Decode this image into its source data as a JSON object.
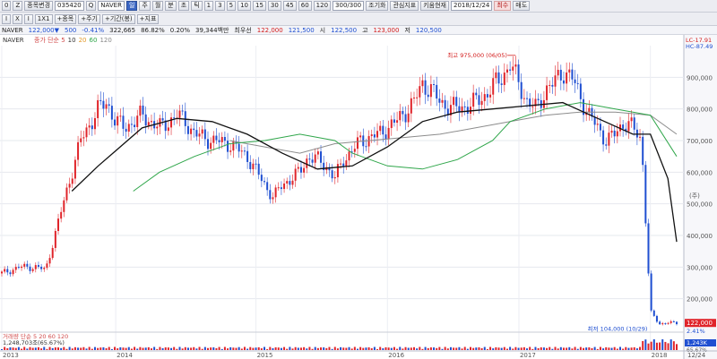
{
  "toolbar1": {
    "items": [
      "0",
      "Z",
      "종목변경",
      "035420",
      "Q",
      "NAVER",
      "일",
      "주",
      "월",
      "분",
      "초",
      "틱",
      "1",
      "3",
      "5",
      "10",
      "15",
      "30",
      "45",
      "60",
      "120",
      "300/300",
      "조기화",
      "관심지표",
      "키움현재",
      "2018/12/24",
      "최수",
      "매도"
    ],
    "indicator_tabs": [
      "+종목",
      "+주기",
      "+기간(봉)",
      "+지표"
    ]
  },
  "toolbar2": {
    "items": [
      "I",
      "X",
      "I",
      "1X1"
    ]
  },
  "info": {
    "name": "NAVER",
    "price": "122,000▼",
    "change": "500",
    "change_pct": "-0.41%",
    "volume": "322,665",
    "turnover": "86.82%",
    "rate": "0.20%",
    "amount": "39,344백만",
    "segment": "최우선",
    "bid": "122,000",
    "ask": "121,500",
    "open_label": "시",
    "open": "122,500",
    "high_label": "고",
    "high": "123,000",
    "low_label": "저",
    "low": "120,500"
  },
  "chart_data": {
    "type": "candlestick",
    "title": "NAVER",
    "legend": [
      "종가 단순 5",
      "10",
      "20",
      "60",
      "120"
    ],
    "x_ticks": [
      "2013",
      "2014",
      "2015",
      "2016",
      "2017",
      "2018",
      "12/24"
    ],
    "y_ticks": [
      900000,
      800000,
      700000,
      600000,
      500000,
      400000,
      300000,
      200000
    ],
    "y_tick_labels": [
      "900,000",
      "800,000",
      "700,000",
      "600,000",
      "500,000",
      "400,000",
      "300,000",
      "200,000"
    ],
    "y_range": [
      100000,
      1000000
    ],
    "right_labels": [
      "(주)",
      "(주)"
    ],
    "lc_label": "LC-17.91",
    "hc_label": "HC-87.49",
    "last_price_label": "122,000",
    "last_pct_label": "2.41%",
    "high_annotation": "최고 975,000 (06/05)",
    "low_annotation": "최저 104,000 (10/29)",
    "volume_legend": "거래량 단순 5 20 60 120",
    "volume_value": "1,248,703조(65.67%)",
    "volume_right_label": "1,243K",
    "volume_right_pct": "65.67%",
    "close_keypoints": [
      [
        0,
        280000
      ],
      [
        2,
        300000
      ],
      [
        4,
        300000
      ],
      [
        5,
        290000
      ],
      [
        7,
        500000
      ],
      [
        9,
        700000
      ],
      [
        11,
        800000
      ],
      [
        12,
        820000
      ],
      [
        13,
        760000
      ],
      [
        14,
        740000
      ],
      [
        15,
        760000
      ],
      [
        16,
        780000
      ],
      [
        17,
        760000
      ],
      [
        18,
        740000
      ],
      [
        19,
        760000
      ],
      [
        20,
        780000
      ],
      [
        21,
        760000
      ],
      [
        22,
        720000
      ],
      [
        24,
        700000
      ],
      [
        26,
        690000
      ],
      [
        28,
        650000
      ],
      [
        30,
        560000
      ],
      [
        31,
        520000
      ],
      [
        32,
        560000
      ],
      [
        34,
        600000
      ],
      [
        35,
        650000
      ],
      [
        36,
        640000
      ],
      [
        37,
        620000
      ],
      [
        38,
        580000
      ],
      [
        39,
        640000
      ],
      [
        41,
        700000
      ],
      [
        43,
        720000
      ],
      [
        45,
        760000
      ],
      [
        47,
        820000
      ],
      [
        48,
        880000
      ],
      [
        49,
        860000
      ],
      [
        50,
        820000
      ],
      [
        52,
        800000
      ],
      [
        54,
        820000
      ],
      [
        55,
        840000
      ],
      [
        56,
        870000
      ],
      [
        57,
        900000
      ],
      [
        58,
        940000
      ],
      [
        59,
        880000
      ],
      [
        60,
        820000
      ],
      [
        61,
        800000
      ],
      [
        62,
        860000
      ],
      [
        63,
        880000
      ],
      [
        64,
        920000
      ],
      [
        65,
        900000
      ],
      [
        66,
        840000
      ],
      [
        67,
        780000
      ],
      [
        68,
        740000
      ],
      [
        69,
        700000
      ],
      [
        70,
        720000
      ],
      [
        71,
        760000
      ],
      [
        72,
        740000
      ],
      [
        73,
        700000
      ],
      [
        74,
        160000
      ],
      [
        75,
        120000
      ],
      [
        76,
        125000
      ],
      [
        77,
        122000
      ]
    ],
    "ma5": [
      [
        8,
        540000
      ],
      [
        11,
        620000
      ],
      [
        16,
        740000
      ],
      [
        20,
        770000
      ],
      [
        24,
        760000
      ],
      [
        28,
        720000
      ],
      [
        32,
        660000
      ],
      [
        36,
        610000
      ],
      [
        40,
        620000
      ],
      [
        44,
        680000
      ],
      [
        48,
        760000
      ],
      [
        52,
        790000
      ],
      [
        56,
        800000
      ],
      [
        60,
        810000
      ],
      [
        64,
        820000
      ],
      [
        68,
        770000
      ],
      [
        72,
        720000
      ],
      [
        74,
        720000
      ],
      [
        76,
        580000
      ],
      [
        77,
        380000
      ]
    ],
    "ma60": [
      [
        15,
        540000
      ],
      [
        18,
        600000
      ],
      [
        22,
        650000
      ],
      [
        26,
        690000
      ],
      [
        30,
        700000
      ],
      [
        34,
        720000
      ],
      [
        38,
        700000
      ],
      [
        40,
        660000
      ],
      [
        44,
        620000
      ],
      [
        48,
        610000
      ],
      [
        52,
        640000
      ],
      [
        56,
        700000
      ],
      [
        58,
        760000
      ],
      [
        62,
        800000
      ],
      [
        66,
        820000
      ],
      [
        70,
        800000
      ],
      [
        74,
        780000
      ],
      [
        77,
        650000
      ]
    ],
    "ma120": [
      [
        26,
        700000
      ],
      [
        30,
        680000
      ],
      [
        34,
        660000
      ],
      [
        38,
        690000
      ],
      [
        42,
        700000
      ],
      [
        46,
        710000
      ],
      [
        50,
        720000
      ],
      [
        54,
        740000
      ],
      [
        58,
        760000
      ],
      [
        62,
        780000
      ],
      [
        66,
        790000
      ],
      [
        70,
        790000
      ],
      [
        74,
        780000
      ],
      [
        77,
        720000
      ]
    ]
  }
}
